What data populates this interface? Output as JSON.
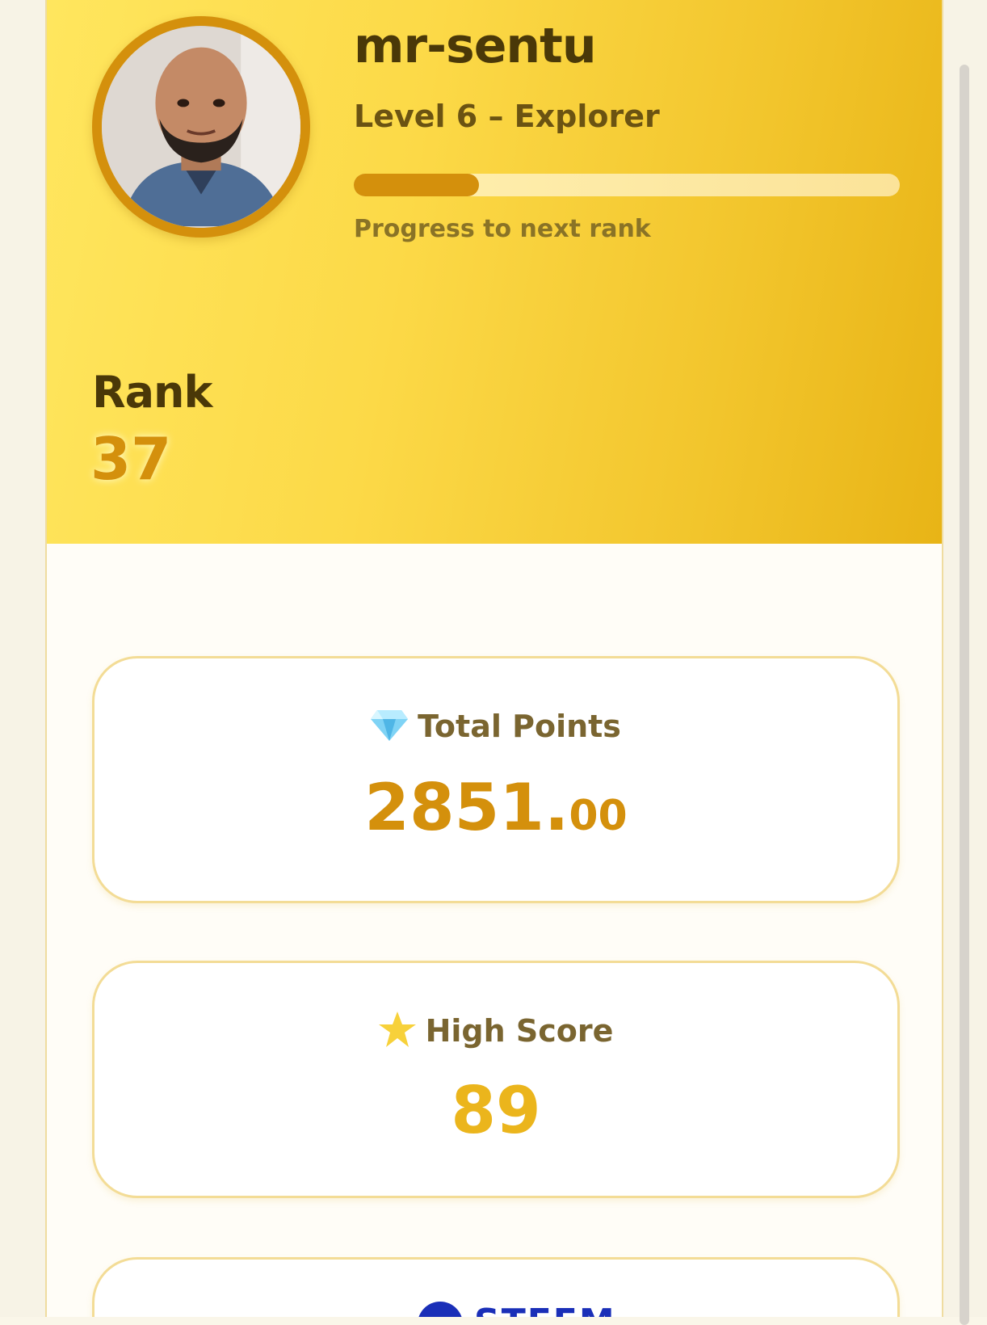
{
  "profile": {
    "username": "mr-sentu",
    "level_text": "Level 6 – Explorer",
    "progress_fraction": 0.23,
    "progress_caption": "Progress to next rank",
    "rank_label": "Rank",
    "rank_value": "37"
  },
  "stats": {
    "points": {
      "icon": "gem-icon",
      "label": "Total Points",
      "value_int": "2851.",
      "value_dec": "00"
    },
    "high_score": {
      "icon": "star-icon",
      "label": "High Score",
      "value": "89"
    },
    "steem": {
      "icon": "steem-logo-icon",
      "label": "STEEM"
    }
  },
  "colors": {
    "accent": "#d4900c",
    "hero_start": "#ffe65e",
    "hero_end": "#e8b416",
    "high_score": "#ebb51c",
    "steem_blue": "#1a2fb8"
  }
}
